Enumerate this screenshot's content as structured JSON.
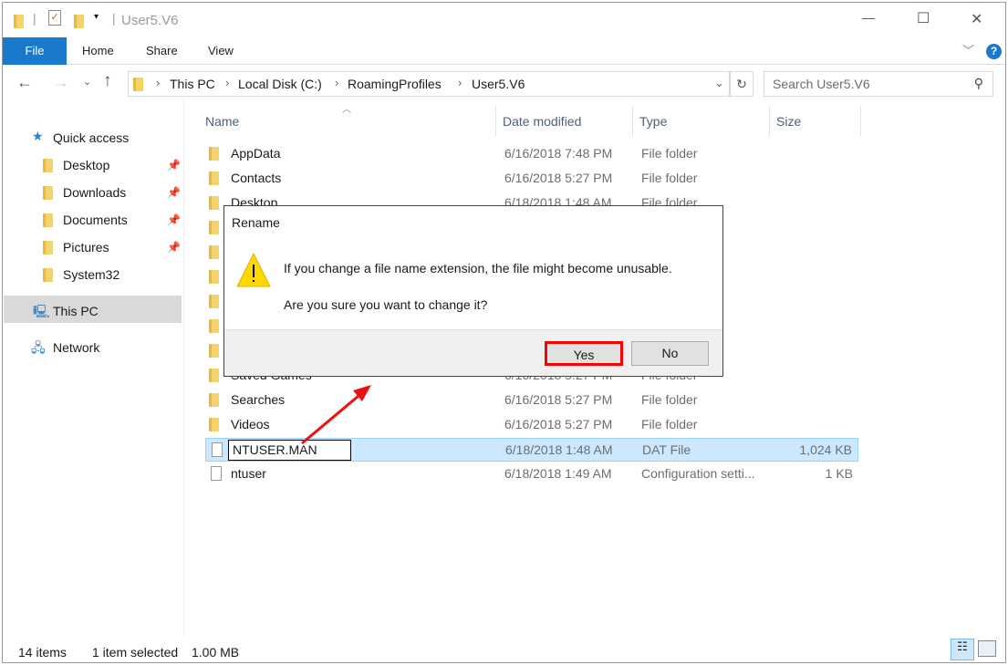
{
  "window": {
    "title": "User5.V6",
    "minimize": "—",
    "maximize": "☐",
    "close": "✕"
  },
  "ribbon": {
    "tabs": [
      "File",
      "Home",
      "Share",
      "View"
    ],
    "help": "?"
  },
  "address": {
    "crumbs": [
      "This PC",
      "Local Disk (C:)",
      "RoamingProfiles",
      "User5.V6"
    ]
  },
  "search": {
    "placeholder": "Search User5.V6"
  },
  "nav": {
    "quick_access": "Quick access",
    "items": [
      "Desktop",
      "Downloads",
      "Documents",
      "Pictures",
      "System32"
    ],
    "this_pc": "This PC",
    "network": "Network"
  },
  "columns": {
    "name": "Name",
    "date": "Date modified",
    "type": "Type",
    "size": "Size"
  },
  "files": [
    {
      "name": "AppData",
      "date": "6/16/2018 7:48 PM",
      "type": "File folder",
      "size": ""
    },
    {
      "name": "Contacts",
      "date": "6/16/2018 5:27 PM",
      "type": "File folder",
      "size": ""
    },
    {
      "name": "Desktop",
      "date": "6/18/2018 1:48 AM",
      "type": "File folder",
      "size": ""
    },
    {
      "name": "Saved Games",
      "date": "6/16/2018 5:27 PM",
      "type": "File folder",
      "size": ""
    },
    {
      "name": "Searches",
      "date": "6/16/2018 5:27 PM",
      "type": "File folder",
      "size": ""
    },
    {
      "name": "Videos",
      "date": "6/16/2018 5:27 PM",
      "type": "File folder",
      "size": ""
    },
    {
      "name": "NTUSER.MAN",
      "date": "6/18/2018 1:48 AM",
      "type": "DAT File",
      "size": "1,024 KB"
    },
    {
      "name": "ntuser",
      "date": "6/18/2018 1:49 AM",
      "type": "Configuration setti...",
      "size": "1 KB"
    }
  ],
  "dialog": {
    "title": "Rename",
    "line1": "If you change a file name extension, the file might become unusable.",
    "line2": "Are you sure you want to change it?",
    "yes": "Yes",
    "no": "No"
  },
  "status": {
    "count": "14 items",
    "selected": "1 item selected",
    "size": "1.00 MB"
  },
  "colors": {
    "accent": "#1979ca",
    "selection": "#cce8ff",
    "highlight": "#ff0000"
  }
}
